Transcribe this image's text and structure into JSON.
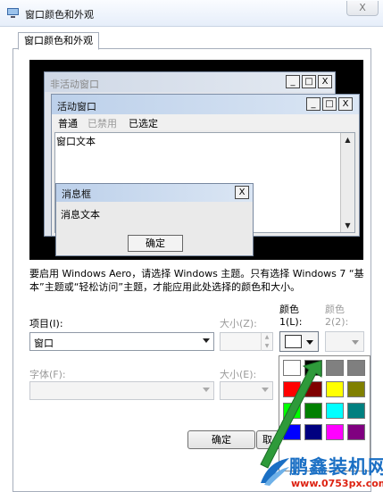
{
  "window": {
    "title": "窗口颜色和外观",
    "close_label": "X"
  },
  "tab": {
    "label": "窗口颜色和外观"
  },
  "preview": {
    "inactive_title": "非活动窗口",
    "active_title": "活动窗口",
    "menu": {
      "normal": "普通",
      "disabled": "已禁用",
      "selected": "已选定"
    },
    "window_text": "窗口文本",
    "msgbox_title": "消息框",
    "msgbox_text": "消息文本",
    "ok_label": "确定",
    "min_glyph": "_",
    "max_glyph": "□",
    "close_glyph": "X"
  },
  "note": "要启用 Windows Aero，请选择 Windows 主题。只有选择 Windows 7 “基本”主题或“轻松访问”主题，才能应用此处选择的颜色和大小。",
  "item": {
    "label": "项目(I):",
    "value": "窗口"
  },
  "size1": {
    "label": "大小(Z):"
  },
  "color1": {
    "label_line1": "颜色",
    "label_line2": "1(L):",
    "swatch": "#ffffff"
  },
  "color2": {
    "label_line1": "颜色",
    "label_line2": "2(2):"
  },
  "font": {
    "label": "字体(F):"
  },
  "size2": {
    "label": "大小(E):"
  },
  "palette": [
    "#ffffff",
    "#000000",
    "#808080",
    "#7f7f7f",
    "#ff0000",
    "#800000",
    "#ffff00",
    "#808000",
    "#00ff00",
    "#008000",
    "#00ffff",
    "#008080",
    "#0000ff",
    "#000080",
    "#ff00ff",
    "#800080"
  ],
  "buttons": {
    "ok": "确定",
    "cancel_partial": "取"
  },
  "watermark": {
    "brand": "鹏鑫装机网",
    "url": "www.0753px.com"
  },
  "colors": {
    "titlebar": "#e6eefa",
    "preview_bg": "#000000",
    "accent_caption": "#bcd0ea",
    "arrow_green": "#2e9a3a"
  }
}
